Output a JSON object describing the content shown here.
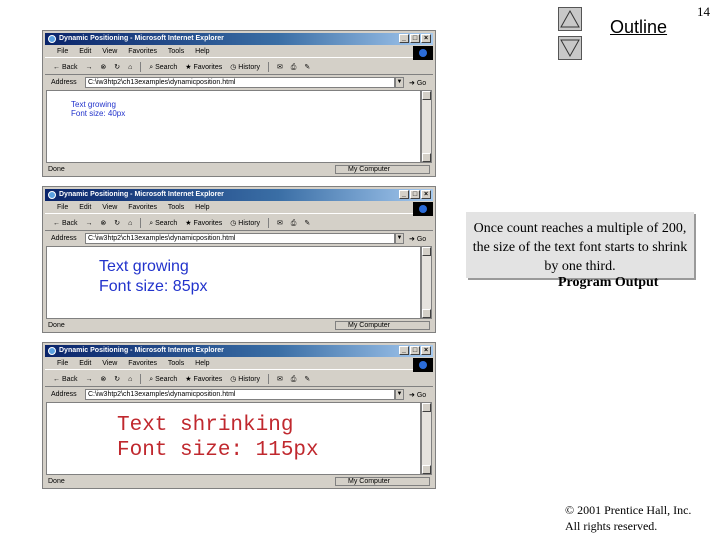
{
  "slide": {
    "number": "14",
    "outline_label": "Outline"
  },
  "callout": {
    "text": "Once count reaches a multiple of 200, the size of the text font starts to shrink by one third."
  },
  "program_output_label": "Program Output",
  "copyright": {
    "line1": "© 2001 Prentice Hall, Inc.",
    "line2": "All rights reserved."
  },
  "browser": {
    "title": "Dynamic Positioning - Microsoft Internet Explorer",
    "menu": [
      "File",
      "Edit",
      "View",
      "Favorites",
      "Tools",
      "Help"
    ],
    "toolbar": {
      "back": "Back",
      "search": "Search",
      "favorites": "Favorites",
      "history": "History"
    },
    "address_label": "Address",
    "address_value": "C:\\iw3htp2\\ch13examples\\dynamicposition.html",
    "go_label": "Go",
    "status_left": "Done",
    "status_zone": "My Computer"
  },
  "windows": [
    {
      "lines": [
        "Text growing",
        "Font size: 40px"
      ]
    },
    {
      "lines": [
        "Text growing",
        "Font size: 85px"
      ]
    },
    {
      "lines": [
        "Text shrinking",
        "Font size: 115px"
      ]
    }
  ],
  "colors": {
    "growing_text": "#2233cc",
    "shrinking_text": "#c0282e",
    "titlebar": "#0a246a"
  }
}
